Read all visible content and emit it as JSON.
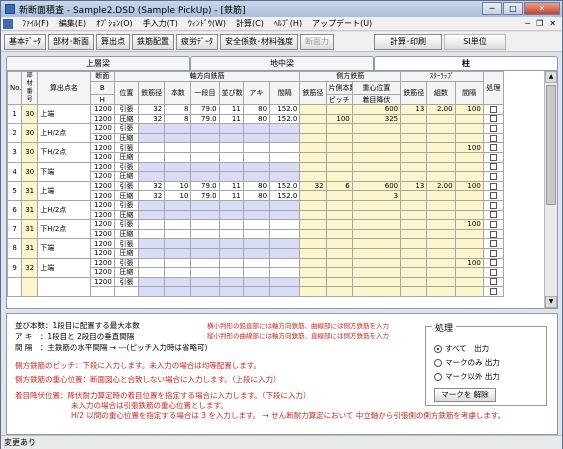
{
  "window": {
    "title": "新断面積査 - Sample2.DSD (Sample PickUp) - [鉄筋]"
  },
  "menu": [
    "ﾌｧｲﾙ(F)",
    "編集(E)",
    "ｵﾌﾟｼｮﾝ(O)",
    "手入力(T)",
    "ｳｨﾝﾄﾞｳ(W)",
    "計算(C)",
    "ﾍﾙﾌﾟ(H)",
    "アップデート(U)"
  ],
  "toolbar": {
    "buttons": [
      "基本ﾃﾞｰﾀ",
      "部材･断面",
      "算出点",
      "鉄筋配置",
      "疲労ﾃﾞｰﾀ",
      "安全係数･材料強度",
      "断面力"
    ],
    "calc": "計算･印刷",
    "unit": "SI単位"
  },
  "tabs": [
    "上層梁",
    "地中梁",
    "柱"
  ],
  "grid": {
    "h": {
      "no": "No.",
      "member": "部材番号",
      "point": "算出点名",
      "section": "断面",
      "b": "B",
      "hh": "H",
      "axial": "軸方向鉄筋",
      "pos": "位置",
      "dia": "鉄筋径",
      "count": "本数",
      "row1": "一段目",
      "row2": "並び数",
      "aki": "アキ",
      "gap": "間隔",
      "side": "側方鉄筋",
      "sdia": "鉄筋径",
      "sside": "片側本数",
      "pitch": "ピッチ",
      "cg": "重心位置",
      "start": "着目降伏",
      "stirrup": "ｽﾀｰﾗｯﾌﾟ",
      "stdia": "鉄筋径",
      "set": "組数",
      "stgap": "間隔",
      "proc": "処理"
    },
    "rows": [
      {
        "no": "1",
        "member": "30",
        "point": "上端",
        "secH": "",
        "h1": "1200",
        "h2": "1200",
        "r1": {
          "pos": "引張",
          "dia": "32",
          "cnt": "8",
          "row": "79.0",
          "nb": "11",
          "aki": "80",
          "gap": "152.0",
          "sdia": "",
          "sside": "",
          "cg": "600",
          "sd": "13",
          "set": "2.00",
          "sg": "100"
        },
        "r2": {
          "pos": "圧縮",
          "dia": "32",
          "cnt": "8",
          "row": "79.0",
          "nb": "11",
          "aki": "80",
          "gap": "152.0",
          "pitch": "100",
          "start": "325"
        }
      },
      {
        "no": "2",
        "member": "30",
        "point": "上H/2点",
        "h1": "1200",
        "h2": "1200",
        "r1": {
          "pos": "引張"
        },
        "r2": {
          "pos": "圧縮"
        }
      },
      {
        "no": "3",
        "member": "30",
        "point": "下H/2点",
        "h1": "1200",
        "h2": "1200",
        "r1": {
          "pos": "引張",
          "sg": "100"
        },
        "r2": {
          "pos": "圧縮"
        }
      },
      {
        "no": "4",
        "member": "30",
        "point": "下端",
        "h1": "1200",
        "h2": "1200",
        "r1": {
          "pos": "引張"
        },
        "r2": {
          "pos": "圧縮"
        }
      },
      {
        "no": "5",
        "member": "31",
        "point": "上端",
        "h1": "1200",
        "h2": "1200",
        "r1": {
          "pos": "引張",
          "dia": "32",
          "cnt": "10",
          "row": "79.0",
          "nb": "11",
          "aki": "80",
          "gap": "152.0",
          "sdia": "32",
          "sside": "6",
          "cg": "600",
          "sd": "13",
          "set": "2.00",
          "sg": "100"
        },
        "r2": {
          "pos": "圧縮",
          "dia": "32",
          "cnt": "10",
          "row": "79.0",
          "nb": "11",
          "aki": "80",
          "gap": "152.0",
          "start": "3"
        }
      },
      {
        "no": "6",
        "member": "31",
        "point": "上H/2点",
        "h1": "1200",
        "h2": "1200",
        "r1": {
          "pos": "引張"
        },
        "r2": {
          "pos": "圧縮"
        }
      },
      {
        "no": "7",
        "member": "31",
        "point": "下H/2点",
        "h1": "1200",
        "h2": "1200",
        "r1": {
          "pos": "引張",
          "sg": "100"
        },
        "r2": {
          "pos": "圧縮"
        }
      },
      {
        "no": "8",
        "member": "31",
        "point": "下端",
        "h1": "1200",
        "h2": "1200",
        "r1": {
          "pos": "引張"
        },
        "r2": {
          "pos": "圧縮"
        }
      },
      {
        "no": "9",
        "member": "32",
        "point": "上端",
        "h1": "1200",
        "h2": "1200",
        "r1": {
          "pos": "引張",
          "sg": "100"
        },
        "r2": {
          "pos": "圧縮"
        }
      },
      {
        "no": "",
        "member": "",
        "point": "",
        "h1": "1200",
        "h2": "",
        "r1": {
          "pos": "引張"
        },
        "r2": {
          "pos": ""
        }
      }
    ]
  },
  "info": {
    "l1": "並び本数：1段目に配置する最大本数",
    "l2": "ア キ　：1段目と 2段目の垂直間隔",
    "l3": "間 隔　：主鉄筋の水平間隔 → ---(ピッチ入力時は省略可)",
    "r1": "横小判形の鉛直部には軸方向鉄筋、曲線部には側方鉄筋を入力",
    "r2": "縦小判形の曲線部には軸方向鉄筋、直線部には側方鉄筋を入力",
    "l4": "側方鉄筋のピッチ：下段に入力します。未入力の場合は均等配置します。",
    "l5": "側方鉄筋の重心位置：断面図心と合致しない場合に入力します。（上段に入力）",
    "l6": "着目降伏位置：降伏耐力算定時の着目位置を指定する場合に入力します。（下段に入力）",
    "l7": "未入力の場合は引張鉄筋の重心位置とします。",
    "l8": "H/2 以間の重心位置を指定する場合は 3 を入力します。 → せん断耐力算定において 中立軸から引張側の側方鉄筋を考慮します。"
  },
  "process": {
    "title": "処理",
    "opt1": "すべて　出力",
    "opt2": "マークのみ 出力",
    "opt3": "マーク以外 出力",
    "clear": "マークを 解除"
  },
  "status": "変更あり"
}
